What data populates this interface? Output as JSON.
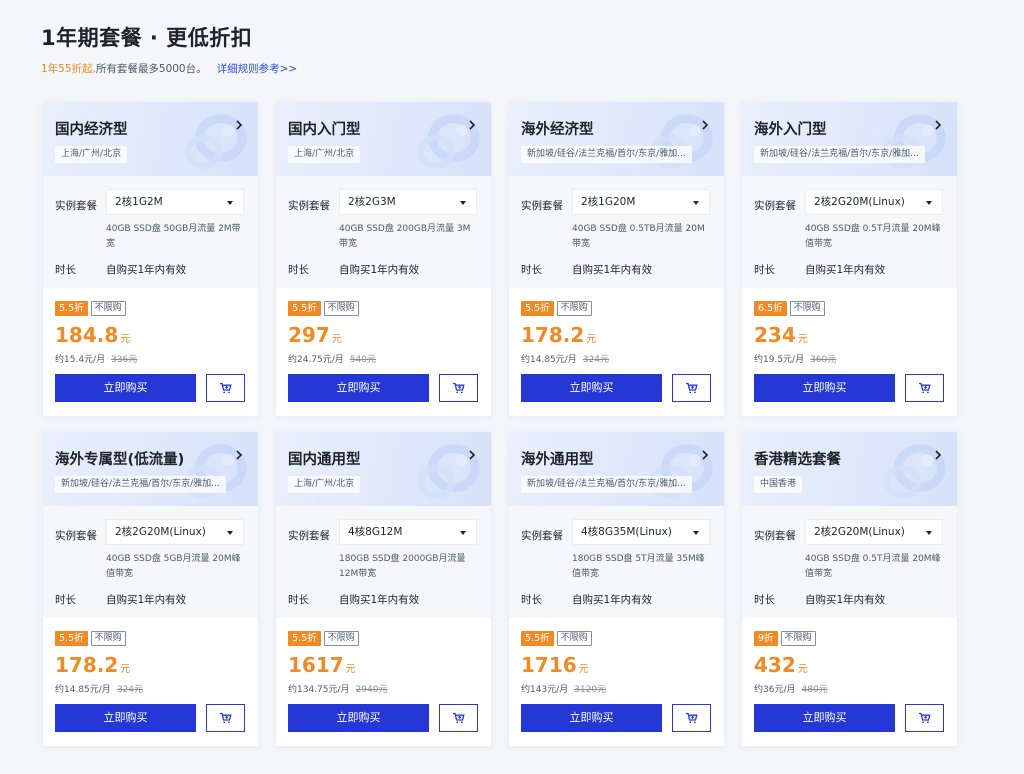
{
  "header": {
    "title": "1年期套餐 · 更低折扣",
    "subtitle_highlight": "1年55折起,",
    "subtitle_rest": "所有套餐最多5000台。",
    "rules_link": "详细规则参考>>"
  },
  "labels": {
    "spec": "实例套餐",
    "duration": "时长",
    "buy": "立即购买",
    "limit": "不限购",
    "unit": "元"
  },
  "colors": {
    "accent": "#f08a24",
    "primary": "#2538d6",
    "header_bg": "#dee7fb"
  },
  "icons": [
    "chevron-right-icon",
    "caret-down-icon",
    "add-to-cart-icon",
    "header-ring-decoration"
  ],
  "cards": [
    {
      "title": "国内经济型",
      "regions": "上海/广州/北京",
      "spec": "2核1G2M",
      "spec_detail": "40GB SSD盘 50GB月流量 2M带宽",
      "duration": "自购买1年内有效",
      "discount": "5.5折",
      "price": "184.8",
      "monthly": "约15.4元/月",
      "original": "336元"
    },
    {
      "title": "国内入门型",
      "regions": "上海/广州/北京",
      "spec": "2核2G3M",
      "spec_detail": "40GB SSD盘 200GB月流量 3M带宽",
      "duration": "自购买1年内有效",
      "discount": "5.5折",
      "price": "297",
      "monthly": "约24.75元/月",
      "original": "540元"
    },
    {
      "title": "海外经济型",
      "regions": "新加坡/硅谷/法兰克福/首尔/东京/雅加...",
      "spec": "2核1G20M",
      "spec_detail": "40GB SSD盘 0.5TB月流量 20M带宽",
      "duration": "自购买1年内有效",
      "discount": "5.5折",
      "price": "178.2",
      "monthly": "约14.85元/月",
      "original": "324元"
    },
    {
      "title": "海外入门型",
      "regions": "新加坡/硅谷/法兰克福/首尔/东京/雅加...",
      "spec": "2核2G20M(Linux)",
      "spec_detail": "40GB SSD盘 0.5T月流量 20M峰值带宽",
      "duration": "自购买1年内有效",
      "discount": "6.5折",
      "price": "234",
      "monthly": "约19.5元/月",
      "original": "360元"
    },
    {
      "title": "海外专属型(低流量)",
      "regions": "新加坡/硅谷/法兰克福/首尔/东京/雅加...",
      "spec": "2核2G20M(Linux)",
      "spec_detail": "40GB SSD盘 5GB月流量 20M峰值带宽",
      "duration": "自购买1年内有效",
      "discount": "5.5折",
      "price": "178.2",
      "monthly": "约14.85元/月",
      "original": "324元"
    },
    {
      "title": "国内通用型",
      "regions": "上海/广州/北京",
      "spec": "4核8G12M",
      "spec_detail": "180GB SSD盘 2000GB月流量 12M带宽",
      "duration": "自购买1年内有效",
      "discount": "5.5折",
      "price": "1617",
      "monthly": "约134.75元/月",
      "original": "2940元"
    },
    {
      "title": "海外通用型",
      "regions": "新加坡/硅谷/法兰克福/首尔/东京/雅加...",
      "spec": "4核8G35M(Linux)",
      "spec_detail": "180GB SSD盘 5T月流量 35M峰值带宽",
      "duration": "自购买1年内有效",
      "discount": "5.5折",
      "price": "1716",
      "monthly": "约143元/月",
      "original": "3120元"
    },
    {
      "title": "香港精选套餐",
      "regions": "中国香港",
      "spec": "2核2G20M(Linux)",
      "spec_detail": "40GB SSD盘 0.5T月流量 20M峰值带宽",
      "duration": "自购买1年内有效",
      "discount": "9折",
      "price": "432",
      "monthly": "约36元/月",
      "original": "480元"
    }
  ]
}
